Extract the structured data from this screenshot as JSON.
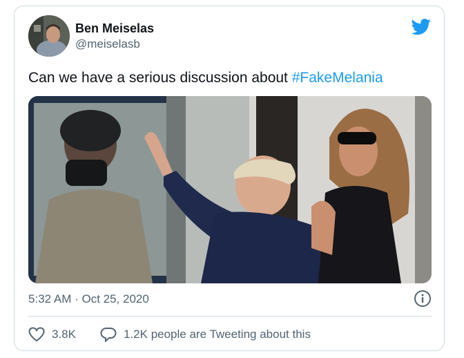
{
  "author": {
    "name": "Ben Meiselas",
    "handle": "@meiselasb"
  },
  "tweet": {
    "text": "Can we have a serious discussion about ",
    "hashtag": "#FakeMelania"
  },
  "meta": {
    "timestamp": "5:32 AM · Oct 25, 2020"
  },
  "actions": {
    "like_count": "3.8K",
    "reply_text": "1.2K people are Tweeting about this"
  },
  "icons": {
    "brand": "twitter-bird-icon",
    "info": "info-icon",
    "like": "heart-icon",
    "reply": "speech-bubble-icon"
  },
  "colors": {
    "brand_blue": "#1d9bf0",
    "text_primary": "#0f1419",
    "text_secondary": "#536471",
    "border": "#cfd9de"
  }
}
